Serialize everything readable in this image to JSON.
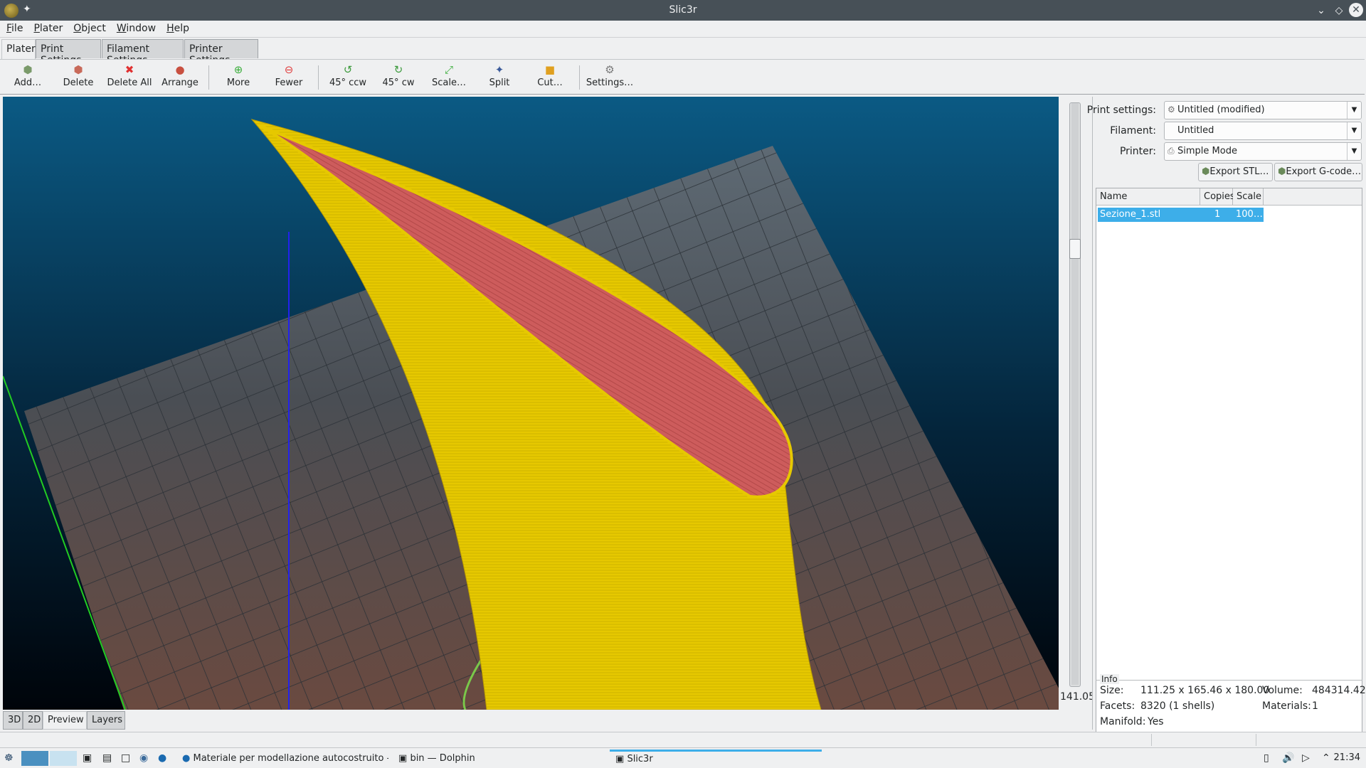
{
  "window": {
    "title": "Slic3r"
  },
  "menu": [
    "File",
    "Plater",
    "Object",
    "Window",
    "Help"
  ],
  "tabs": [
    "Plater",
    "Print Settings",
    "Filament Settings",
    "Printer Settings"
  ],
  "toolbar": {
    "add": "Add…",
    "delete": "Delete",
    "delete_all": "Delete All",
    "arrange": "Arrange",
    "more": "More",
    "fewer": "Fewer",
    "rotate_ccw": "45° ccw",
    "rotate_cw": "45° cw",
    "scale": "Scale…",
    "split": "Split",
    "cut": "Cut…",
    "settings": "Settings…"
  },
  "colors": {
    "accent": "#3daee9",
    "model": "#e6c800",
    "top_surface": "#cd5c5c",
    "bed_grid": "#5a6670",
    "sky": "#0b5a84"
  },
  "layer_slider": {
    "value": "141.05",
    "position": 0.76
  },
  "view_tabs": [
    "3D",
    "2D",
    "Preview",
    "Layers"
  ],
  "settings": {
    "print_label": "Print settings:",
    "print_value": "Untitled (modified)",
    "filament_label": "Filament:",
    "filament_value": "Untitled",
    "printer_label": "Printer:",
    "printer_value": "Simple Mode",
    "export_stl": "Export STL…",
    "export_gcode": "Export G-code…"
  },
  "object_table": {
    "headers": [
      "Name",
      "Copies",
      "Scale"
    ],
    "rows": [
      {
        "name": "Sezione_1.stl",
        "copies": "1",
        "scale": "100…"
      }
    ]
  },
  "info": {
    "title": "Info",
    "size_label": "Size:",
    "size_value": "111.25 x 165.46 x 180.00",
    "volume_label": "Volume:",
    "volume_value": "484314.42",
    "facets_label": "Facets:",
    "facets_value": "8320 (1 shells)",
    "materials_label": "Materials:",
    "materials_value": "1",
    "manifold_label": "Manifold:",
    "manifold_value": "Yes"
  },
  "taskbar": {
    "tasks": [
      "Materiale per modellazione autocostruito - pa",
      "bin — Dolphin",
      "Slic3r"
    ],
    "clock": "21:34"
  }
}
